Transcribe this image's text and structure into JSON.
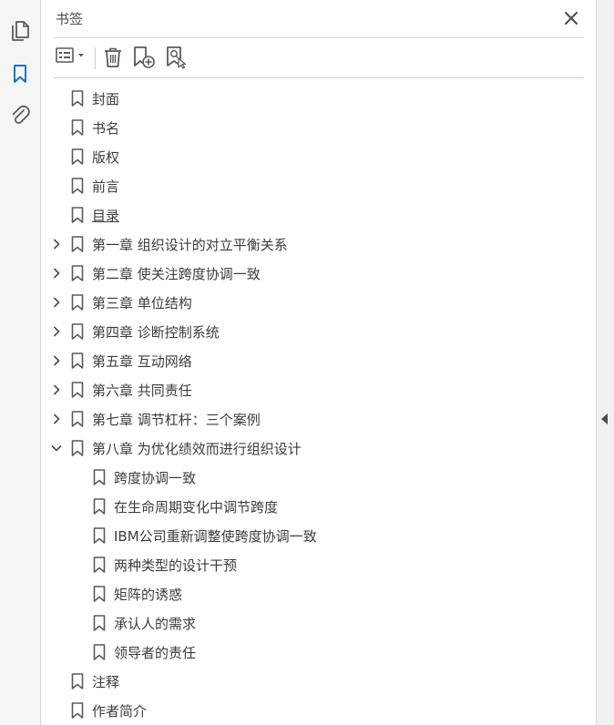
{
  "sidebar_tools": [
    {
      "name": "pages-icon"
    },
    {
      "name": "bookmarks-icon",
      "active": true
    },
    {
      "name": "attachments-icon"
    }
  ],
  "panel": {
    "title": "书签",
    "close_icon": "close-icon"
  },
  "toolbar": {
    "options": "options-menu-icon",
    "delete": "delete-bookmark-icon",
    "new": "new-bookmark-icon",
    "find": "find-current-bookmark-icon"
  },
  "bookmarks": [
    {
      "label": "封面",
      "level": 0,
      "expandable": false
    },
    {
      "label": "书名",
      "level": 0,
      "expandable": false
    },
    {
      "label": "版权",
      "level": 0,
      "expandable": false
    },
    {
      "label": "前言",
      "level": 0,
      "expandable": false
    },
    {
      "label": "目录",
      "level": 0,
      "expandable": false,
      "underline": true
    },
    {
      "label": "第一章  组织设计的对立平衡关系",
      "level": 0,
      "expandable": true,
      "expanded": false
    },
    {
      "label": "第二章  使关注跨度协调一致",
      "level": 0,
      "expandable": true,
      "expanded": false
    },
    {
      "label": "第三章  单位结构",
      "level": 0,
      "expandable": true,
      "expanded": false
    },
    {
      "label": "第四章  诊断控制系统",
      "level": 0,
      "expandable": true,
      "expanded": false
    },
    {
      "label": "第五章  互动网络",
      "level": 0,
      "expandable": true,
      "expanded": false
    },
    {
      "label": "第六章  共同责任",
      "level": 0,
      "expandable": true,
      "expanded": false
    },
    {
      "label": "第七章  调节杠杆：三个案例",
      "level": 0,
      "expandable": true,
      "expanded": false
    },
    {
      "label": "第八章  为优化绩效而进行组织设计",
      "level": 0,
      "expandable": true,
      "expanded": true
    },
    {
      "label": "跨度协调一致",
      "level": 1,
      "expandable": false
    },
    {
      "label": "在生命周期变化中调节跨度",
      "level": 1,
      "expandable": false
    },
    {
      "label": "IBM公司重新调整使跨度协调一致",
      "level": 1,
      "expandable": false
    },
    {
      "label": "两种类型的设计干预",
      "level": 1,
      "expandable": false
    },
    {
      "label": "矩阵的诱惑",
      "level": 1,
      "expandable": false
    },
    {
      "label": "承认人的需求",
      "level": 1,
      "expandable": false
    },
    {
      "label": "领导者的责任",
      "level": 1,
      "expandable": false
    },
    {
      "label": "注释",
      "level": 0,
      "expandable": false
    },
    {
      "label": "作者简介",
      "level": 0,
      "expandable": false
    }
  ],
  "colors": {
    "accent": "#1a73c9",
    "icon": "#5a5a5a",
    "text": "#3c3c3c"
  }
}
